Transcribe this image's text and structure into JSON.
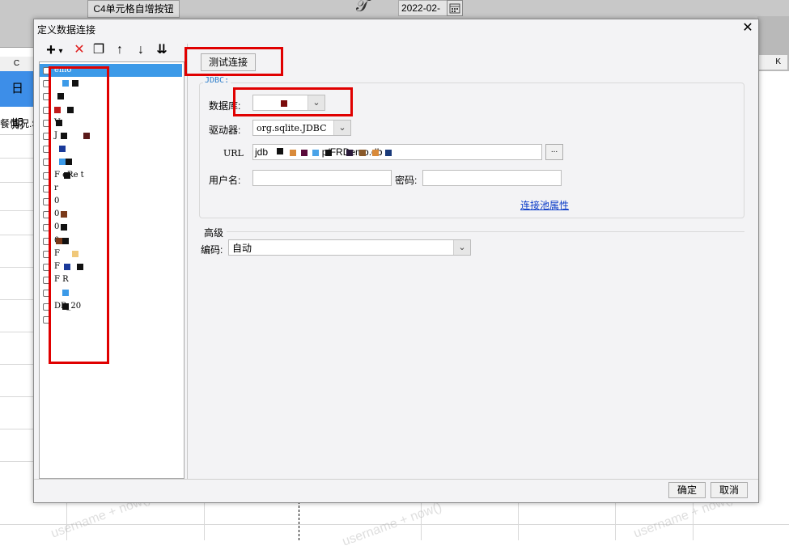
{
  "background": {
    "toolbar_button": "C4单元格自增按钮",
    "date_value": "2022-02-",
    "col_c": "C",
    "col_k": "K",
    "cell_date": "日期",
    "cell_text": "餐情况.S",
    "watermark": "username + now()"
  },
  "dialog": {
    "title": "定义数据连接",
    "close": "✕",
    "ok": "确定",
    "cancel": "取消"
  },
  "toolbar": {
    "add": "+",
    "add_arrow": "▾",
    "delete": "✕",
    "copy": "❐",
    "up": "↑",
    "down": "↓",
    "sort": "⇊"
  },
  "tree": {
    "items": [
      {
        "label": "emo"
      },
      {
        "label": ""
      },
      {
        "label": ""
      },
      {
        "label": ""
      },
      {
        "label": "V"
      },
      {
        "label": "J"
      },
      {
        "label": ""
      },
      {
        "label": ""
      },
      {
        "label": "F eRe t"
      },
      {
        "label": "r"
      },
      {
        "label": "0"
      },
      {
        "label": "0"
      },
      {
        "label": "0"
      },
      {
        "label": "0"
      },
      {
        "label": "F"
      },
      {
        "label": "F"
      },
      {
        "label": "F R"
      },
      {
        "label": ""
      },
      {
        "label": "DB_20"
      },
      {
        "label": ""
      }
    ]
  },
  "form": {
    "test_button": "测试连接",
    "group_title": "JDBC:",
    "database_label": "数据库:",
    "database_value": "",
    "driver_label": "驱动器:",
    "driver_value": "org.sqlite.JDBC",
    "url_label": "URL",
    "url_value": "jdb                    p/FRDemo.db",
    "url_browse": "...",
    "user_label": "用户名:",
    "user_value": "",
    "password_label": "密码:",
    "password_value": "",
    "pool_link": "连接池属性",
    "advanced_label": "高级",
    "encoding_label": "编码:",
    "encoding_value": "自动"
  },
  "icons": [
    "plus-icon",
    "delete-icon",
    "copy-icon",
    "arrow-up-icon",
    "arrow-down-icon",
    "sort-icon",
    "chevron-down-icon",
    "close-icon"
  ]
}
